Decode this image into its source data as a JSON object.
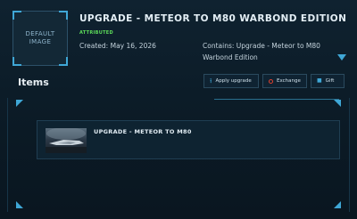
{
  "header": {
    "thumbnail_label": "DEFAULT IMAGE",
    "title": "UPGRADE - METEOR TO M80 WARBOND EDITION",
    "tag": "ATTRIBUTED",
    "created": "Created: May 16, 2026",
    "contains": "Contains: Upgrade - Meteor to M80 Warbond Edition",
    "expand_icon": "chevron-down-icon"
  },
  "items_section": {
    "heading": "Items",
    "actions": [
      {
        "label": "Apply upgrade",
        "icon": "upload-icon"
      },
      {
        "label": "Exchange",
        "icon": "exchange-icon"
      },
      {
        "label": "Gift",
        "icon": "gift-icon"
      }
    ],
    "items": [
      {
        "name": "UPGRADE - METEOR TO M80",
        "image": "ship-image"
      }
    ]
  },
  "colors": {
    "background": "#0b1b27",
    "accent": "#3fa7d6",
    "tag_green": "#5ddc5a",
    "exchange_red": "#e0412f"
  }
}
